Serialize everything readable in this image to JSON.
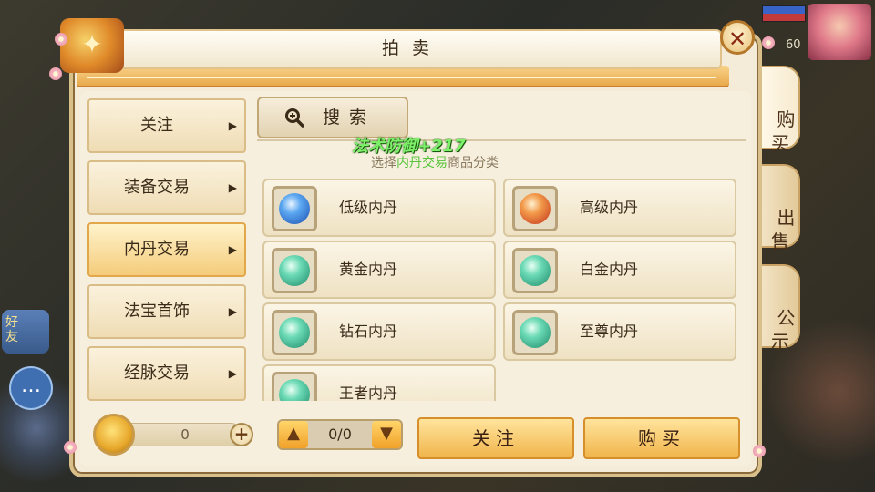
{
  "window": {
    "title": "拍卖",
    "close_glyph": "✕"
  },
  "side_tabs": [
    {
      "label": "购\n买",
      "active": true
    },
    {
      "label": "出\n售",
      "active": false
    },
    {
      "label": "公\n示",
      "active": false
    }
  ],
  "categories": [
    {
      "label": "关注",
      "active": false
    },
    {
      "label": "装备交易",
      "active": false
    },
    {
      "label": "内丹交易",
      "active": true
    },
    {
      "label": "法宝首饰",
      "active": false
    },
    {
      "label": "经脉交易",
      "active": false
    }
  ],
  "search": {
    "label": "搜索",
    "icon": "magnifier-icon"
  },
  "floating_text": "法术防御+217",
  "hint": {
    "prefix": "选择",
    "highlight": "内丹交易",
    "suffix": "商品分类"
  },
  "items": [
    {
      "name": "低级内丹",
      "icon": "blue-gem-icon"
    },
    {
      "name": "高级内丹",
      "icon": "red-gem-icon"
    },
    {
      "name": "黄金内丹",
      "icon": "green-gem-icon"
    },
    {
      "name": "白金内丹",
      "icon": "green-gem-icon"
    },
    {
      "name": "钻石内丹",
      "icon": "green-gem-icon"
    },
    {
      "name": "至尊内丹",
      "icon": "green-gem-icon"
    },
    {
      "name": "王者内丹",
      "icon": "green-gem-icon"
    }
  ],
  "currency": {
    "amount": "0",
    "plus": "+"
  },
  "pager": {
    "text": "0/0",
    "prev_glyph": "▲",
    "next_glyph": "▼"
  },
  "actions": {
    "follow": "关注",
    "buy": "购买"
  },
  "background": {
    "level": "60",
    "friend_label": "好\n友",
    "chat_glyph": "…"
  },
  "colors": {
    "accent": "#f1b54c",
    "highlight_text": "#58c43c",
    "floating_text": "#7df06a"
  }
}
